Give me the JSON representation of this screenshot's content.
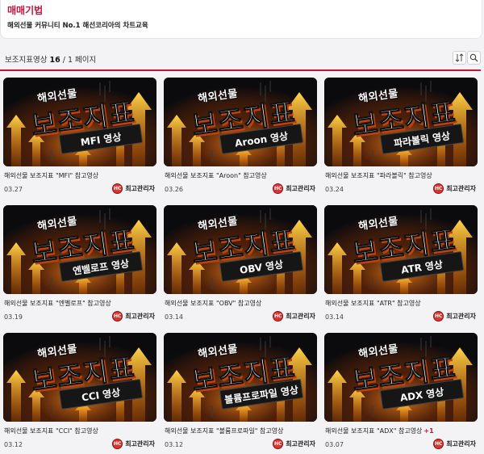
{
  "header": {
    "title": "매매기법",
    "description": "해외선물 커뮤니티 No.1 해선코리아의 차트교육"
  },
  "toolbar": {
    "label": "보조지표영상",
    "count": "16",
    "pages": "/ 1 페이지",
    "sort_icon": "sort-icon",
    "search_icon": "search-icon"
  },
  "colors": {
    "accent": "#c4163d",
    "thumb_glow": "#ff8a1a",
    "avatar": "#e0322e"
  },
  "thumb_common": {
    "line1": "해외선물",
    "line2": "보조지표"
  },
  "posts": [
    {
      "banner": "MFI 영상",
      "title": "해외선물 보조지표 \"MFI\" 참고영상",
      "date": "03.27",
      "author": "최고관리자",
      "badge": ""
    },
    {
      "banner": "Aroon 영상",
      "title": "해외선물 보조지표 \"Aroon\" 참고영상",
      "date": "03.26",
      "author": "최고관리자",
      "badge": ""
    },
    {
      "banner": "파라볼릭 영상",
      "title": "해외선물 보조지표 \"파라볼릭\" 참고영상",
      "date": "03.24",
      "author": "최고관리자",
      "badge": ""
    },
    {
      "banner": "엔벨로프 영상",
      "title": "해외선물 보조지표 \"엔벨로프\" 참고영상",
      "date": "03.19",
      "author": "최고관리자",
      "badge": ""
    },
    {
      "banner": "OBV 영상",
      "title": "해외선물 보조지표 \"OBV\" 참고영상",
      "date": "03.14",
      "author": "최고관리자",
      "badge": ""
    },
    {
      "banner": "ATR 영상",
      "title": "해외선물 보조지표 \"ATR\" 참고영상",
      "date": "03.14",
      "author": "최고관리자",
      "badge": ""
    },
    {
      "banner": "CCI 영상",
      "title": "해외선물 보조지표 \"CCI\" 참고영상",
      "date": "03.12",
      "author": "최고관리자",
      "badge": ""
    },
    {
      "banner": "볼륨프로파일 영상",
      "title": "해외선물 보조지표 \"볼륨프로파일\" 참고영상",
      "date": "03.12",
      "author": "최고관리자",
      "badge": ""
    },
    {
      "banner": "ADX 영상",
      "title": "해외선물 보조지표 \"ADX\" 참고영상",
      "date": "03.07",
      "author": "최고관리자",
      "badge": "+1"
    }
  ]
}
